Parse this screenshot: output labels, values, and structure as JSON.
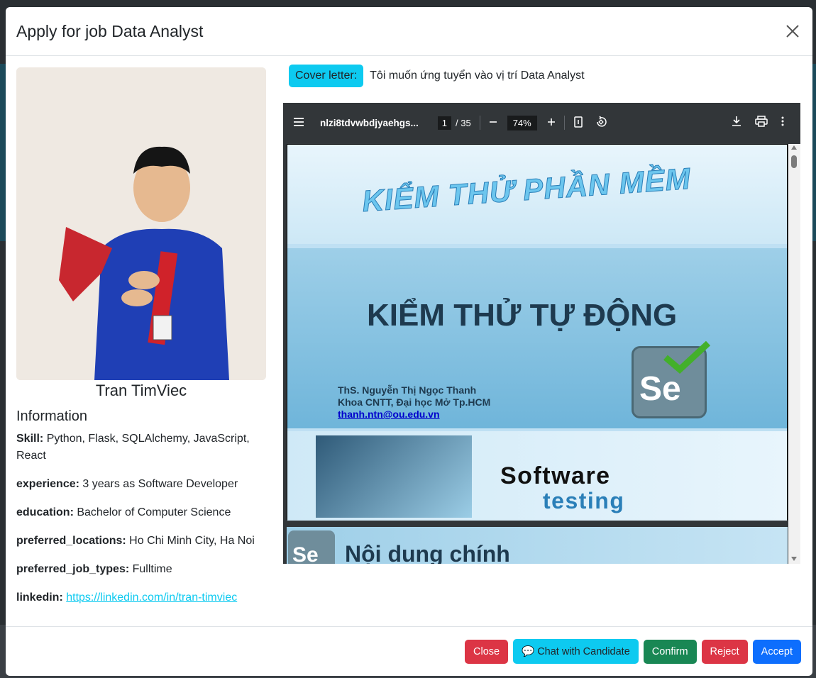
{
  "modal": {
    "title": "Apply for job Data Analyst"
  },
  "candidate": {
    "name": "Tran TimViec",
    "info_title": "Information",
    "fields": [
      {
        "label": "Skill:",
        "value": "Python, Flask, SQLAlchemy, JavaScript, React"
      },
      {
        "label": "experience:",
        "value": "3 years as Software Developer"
      },
      {
        "label": "education:",
        "value": "Bachelor of Computer Science"
      },
      {
        "label": "preferred_locations:",
        "value": "Ho Chi Minh City, Ha Noi"
      },
      {
        "label": "preferred_job_types:",
        "value": "Fulltime"
      },
      {
        "label": "linkedin:",
        "value": "https://linkedin.com/in/tran-timviec"
      }
    ]
  },
  "cover": {
    "badge": "Cover letter:",
    "text": "Tôi muốn ứng tuyển vào vị trí Data Analyst"
  },
  "pdf": {
    "filename": "nlzi8tdvwbdjyaehgs...",
    "page": "1",
    "total": "/ 35",
    "zoom": "74%",
    "slide1": {
      "art_title": "KIỂM THỬ PHẦN MỀM",
      "main_title": "KIỂM THỬ TỰ ĐỘNG",
      "author1": "ThS. Nguyễn Thị Ngọc Thanh",
      "author2": "Khoa CNTT, Đại học Mở Tp.HCM",
      "email": "thanh.ntn@ou.edu.vn",
      "se": "Se",
      "software": "Software",
      "testing": "testing"
    },
    "slide2": {
      "se": "Se",
      "title": "Nội dung chính"
    }
  },
  "footer": {
    "close": "Close",
    "chat": "💬 Chat with Candidate",
    "confirm": "Confirm",
    "reject": "Reject",
    "accept": "Accept"
  }
}
